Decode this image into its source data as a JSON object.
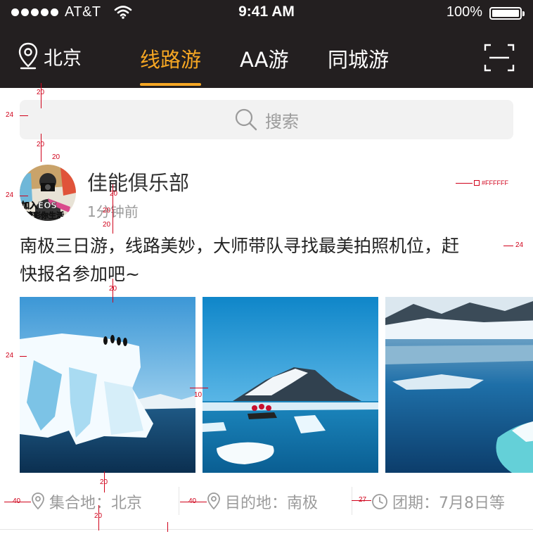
{
  "status_bar": {
    "carrier": "AT&T",
    "time": "9:41 AM",
    "battery": "100%"
  },
  "nav": {
    "location": "北京",
    "tabs": [
      {
        "label": "线路游",
        "active": true
      },
      {
        "label": "AA游",
        "active": false
      },
      {
        "label": "同城游",
        "active": false
      }
    ]
  },
  "search": {
    "placeholder": "搜索"
  },
  "post": {
    "club_name": "佳能俱乐部",
    "time_ago": "1分钟前",
    "text_line1": "南极三日游，线路美妙，大师带队寻找最美拍照机位，赶",
    "text_line2": "快报名参加吧~",
    "avatar_text_1": "加入EOS",
    "avatar_text_2": "精彩你生活",
    "info": {
      "meeting_point": "集合地：北京",
      "destination": "目的地：南极",
      "dates": "团期：7月8日等"
    }
  },
  "colors": {
    "header_bg": "#231f20",
    "accent": "#f5a623",
    "text_gray": "#9b9b9b",
    "annotation": "#d0021b"
  },
  "annotations": {
    "a20": "20",
    "a24": "24",
    "a40": "40",
    "a10": "10",
    "a27": "27",
    "white_color": "#FFFFFF"
  }
}
